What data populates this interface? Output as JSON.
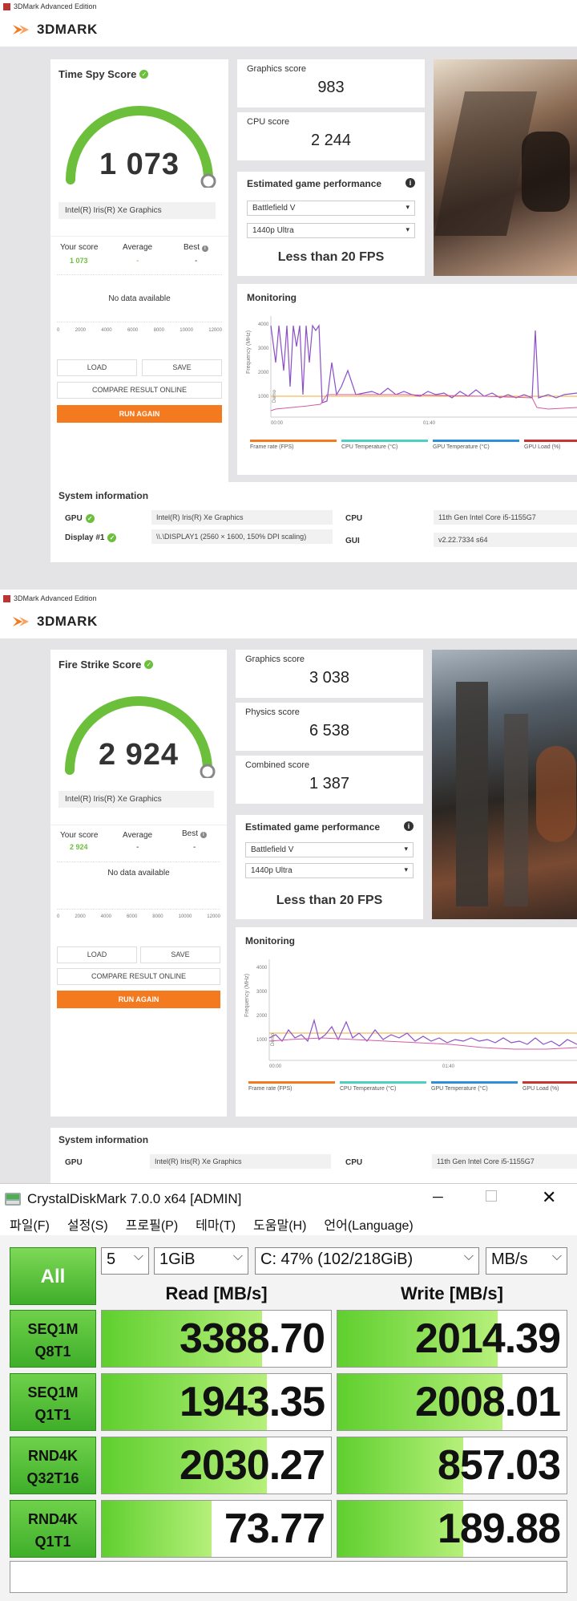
{
  "timespy": {
    "window_title": "3DMark Advanced Edition",
    "logo": "3DMARK",
    "score_title": "Time Spy Score",
    "score": "1 073",
    "gpu_name": "Intel(R) Iris(R) Xe Graphics",
    "your_score_label": "Your score",
    "average_label": "Average",
    "best_label": "Best",
    "your_score": "1 073",
    "average": "-",
    "best": "-",
    "no_data": "No data available",
    "axis_ticks": [
      "0",
      "2000",
      "4000",
      "6000",
      "8000",
      "10000",
      "12000"
    ],
    "load": "LOAD",
    "save": "SAVE",
    "compare": "COMPARE RESULT ONLINE",
    "run_again": "RUN AGAIN",
    "cards": [
      {
        "label": "Graphics score",
        "value": "983"
      },
      {
        "label": "CPU score",
        "value": "2 244"
      }
    ],
    "est_title": "Estimated game performance",
    "game": "Battlefield V",
    "resolution": "1440p Ultra",
    "fps": "Less than 20 FPS",
    "monitoring": "Monitoring",
    "y_ticks": [
      "4000",
      "3000",
      "2000",
      "1000"
    ],
    "y_label": "Frequency (MHz)",
    "x_ticks": [
      "00:00",
      "01:40"
    ],
    "demo_label": "Demo",
    "legend": [
      "Frame rate (FPS)",
      "CPU Temperature (°C)",
      "GPU Temperature (°C)",
      "GPU Load (%)"
    ],
    "sys_title": "System information",
    "sys": {
      "gpu_label": "GPU",
      "gpu": "Intel(R) Iris(R) Xe Graphics",
      "display_label": "Display #1",
      "display": "\\\\.\\DISPLAY1 (2560 × 1600, 150% DPI scaling)",
      "cpu_label": "CPU",
      "cpu": "11th Gen Intel Core i5-1155G7",
      "gui_label": "GUI",
      "gui": "v2.22.7334 s64"
    }
  },
  "firestrike": {
    "window_title": "3DMark Advanced Edition",
    "logo": "3DMARK",
    "score_title": "Fire Strike Score",
    "score": "2 924",
    "gpu_name": "Intel(R) Iris(R) Xe Graphics",
    "your_score_label": "Your score",
    "average_label": "Average",
    "best_label": "Best",
    "your_score": "2 924",
    "average": "-",
    "best": "-",
    "no_data": "No data available",
    "axis_ticks": [
      "0",
      "2000",
      "4000",
      "6000",
      "8000",
      "10000",
      "12000"
    ],
    "load": "LOAD",
    "save": "SAVE",
    "compare": "COMPARE RESULT ONLINE",
    "run_again": "RUN AGAIN",
    "cards": [
      {
        "label": "Graphics score",
        "value": "3 038"
      },
      {
        "label": "Physics score",
        "value": "6 538"
      },
      {
        "label": "Combined score",
        "value": "1 387"
      }
    ],
    "est_title": "Estimated game performance",
    "game": "Battlefield V",
    "resolution": "1440p Ultra",
    "fps": "Less than 20 FPS",
    "monitoring": "Monitoring",
    "y_ticks": [
      "4000",
      "3000",
      "2000",
      "1000"
    ],
    "y_label": "Frequency (MHz)",
    "x_ticks": [
      "00:00",
      "01:40"
    ],
    "demo_label": "Demo",
    "legend": [
      "Frame rate (FPS)",
      "CPU Temperature (°C)",
      "GPU Temperature (°C)",
      "GPU Load (%)"
    ],
    "sys_title": "System information",
    "sys": {
      "gpu_label": "GPU",
      "gpu": "Intel(R) Iris(R) Xe Graphics",
      "cpu_label": "CPU",
      "cpu": "11th Gen Intel Core i5-1155G7"
    }
  },
  "cdm": {
    "title": "CrystalDiskMark 7.0.0 x64 [ADMIN]",
    "menu": [
      "파일(F)",
      "설정(S)",
      "프로필(P)",
      "테마(T)",
      "도움말(H)",
      "언어(Language)"
    ],
    "count": "5",
    "size": "1GiB",
    "drive": "C: 47% (102/218GiB)",
    "unit": "MB/s",
    "all": "All",
    "read_header": "Read [MB/s]",
    "write_header": "Write [MB/s]",
    "rows": [
      {
        "l1": "SEQ1M",
        "l2": "Q8T1",
        "read": "3388.70",
        "write": "2014.39",
        "read_fill": 0.7,
        "write_fill": 0.7
      },
      {
        "l1": "SEQ1M",
        "l2": "Q1T1",
        "read": "1943.35",
        "write": "2008.01",
        "read_fill": 0.72,
        "write_fill": 0.72
      },
      {
        "l1": "RND4K",
        "l2": "Q32T16",
        "read": "2030.27",
        "write": "857.03",
        "read_fill": 0.72,
        "write_fill": 0.55
      },
      {
        "l1": "RND4K",
        "l2": "Q1T1",
        "read": "73.77",
        "write": "189.88",
        "read_fill": 0.48,
        "write_fill": 0.55
      }
    ],
    "colors": {
      "accent": "#3fae2a",
      "orange": "#f47a20"
    }
  }
}
